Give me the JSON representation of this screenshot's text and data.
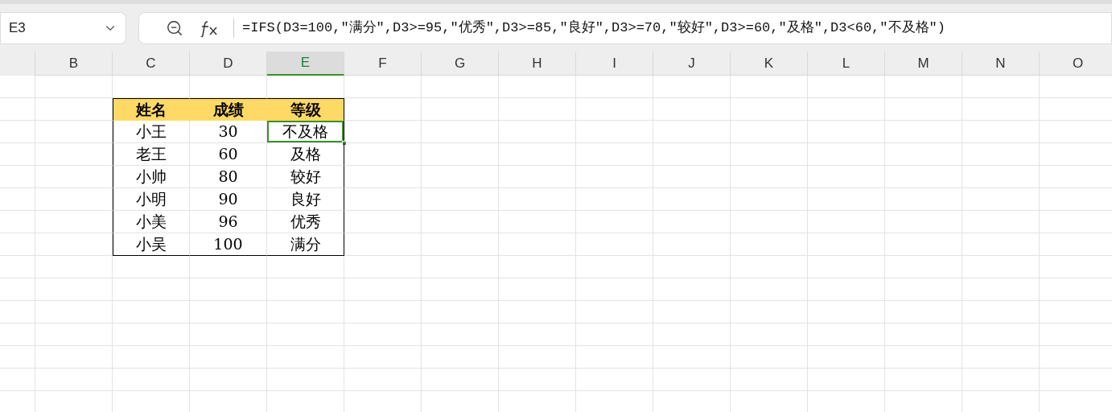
{
  "name_box": {
    "value": "E3"
  },
  "formula_bar": {
    "formula": "=IFS(D3=100,\"满分\",D3>=95,\"优秀\",D3>=85,\"良好\",D3>=70,\"较好\",D3>=60,\"及格\",D3<60,\"不及格\")"
  },
  "columns": [
    {
      "label": "B",
      "selected": false
    },
    {
      "label": "C",
      "selected": false
    },
    {
      "label": "D",
      "selected": false
    },
    {
      "label": "E",
      "selected": true
    },
    {
      "label": "F",
      "selected": false
    },
    {
      "label": "G",
      "selected": false
    },
    {
      "label": "H",
      "selected": false
    },
    {
      "label": "I",
      "selected": false
    },
    {
      "label": "J",
      "selected": false
    },
    {
      "label": "K",
      "selected": false
    },
    {
      "label": "L",
      "selected": false
    },
    {
      "label": "M",
      "selected": false
    },
    {
      "label": "N",
      "selected": false
    },
    {
      "label": "O",
      "selected": false
    }
  ],
  "table": {
    "header": [
      "姓名",
      "成绩",
      "等级"
    ],
    "rows": [
      [
        {
          "text": "小王",
          "selected": false
        },
        {
          "text": "30",
          "selected": false
        },
        {
          "text": "不及格",
          "selected": true
        }
      ],
      [
        {
          "text": "老王",
          "selected": false
        },
        {
          "text": "60",
          "selected": false
        },
        {
          "text": "及格",
          "selected": false
        }
      ],
      [
        {
          "text": "小帅",
          "selected": false
        },
        {
          "text": "80",
          "selected": false
        },
        {
          "text": "较好",
          "selected": false
        }
      ],
      [
        {
          "text": "小明",
          "selected": false
        },
        {
          "text": "90",
          "selected": false
        },
        {
          "text": "良好",
          "selected": false
        }
      ],
      [
        {
          "text": "小美",
          "selected": false
        },
        {
          "text": "96",
          "selected": false
        },
        {
          "text": "优秀",
          "selected": false
        }
      ],
      [
        {
          "text": "小吴",
          "selected": false
        },
        {
          "text": "100",
          "selected": false
        },
        {
          "text": "满分",
          "selected": false
        }
      ]
    ]
  }
}
